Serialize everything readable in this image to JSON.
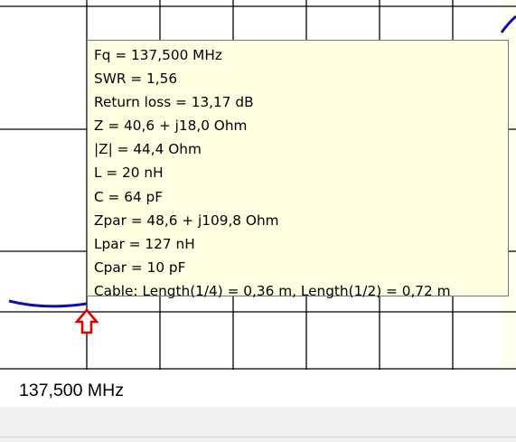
{
  "tooltip": {
    "lines": [
      "Fq = 137,500 MHz",
      "SWR = 1,56",
      "Return loss = 13,17 dB",
      "Z = 40,6 + j18,0 Ohm",
      "|Z| = 44,4 Ohm",
      "L = 20 nH",
      "C = 64 pF",
      "Zpar = 48,6 + j109,8 Ohm",
      "Lpar = 127 nH",
      "Cpar = 10 pF",
      "Cable: Length(1/4) = 0,36 m, Length(1/2) = 0,72 m"
    ]
  },
  "readout": {
    "frequency": "137,500 MHz"
  },
  "colors": {
    "grid": "#000000",
    "curve": "#1010a8",
    "marker": "#e00000",
    "tooltip_bg": "#ffffe1",
    "right_band": "#fffff0"
  },
  "icons": {
    "marker": "arrow-up-outline-icon"
  }
}
